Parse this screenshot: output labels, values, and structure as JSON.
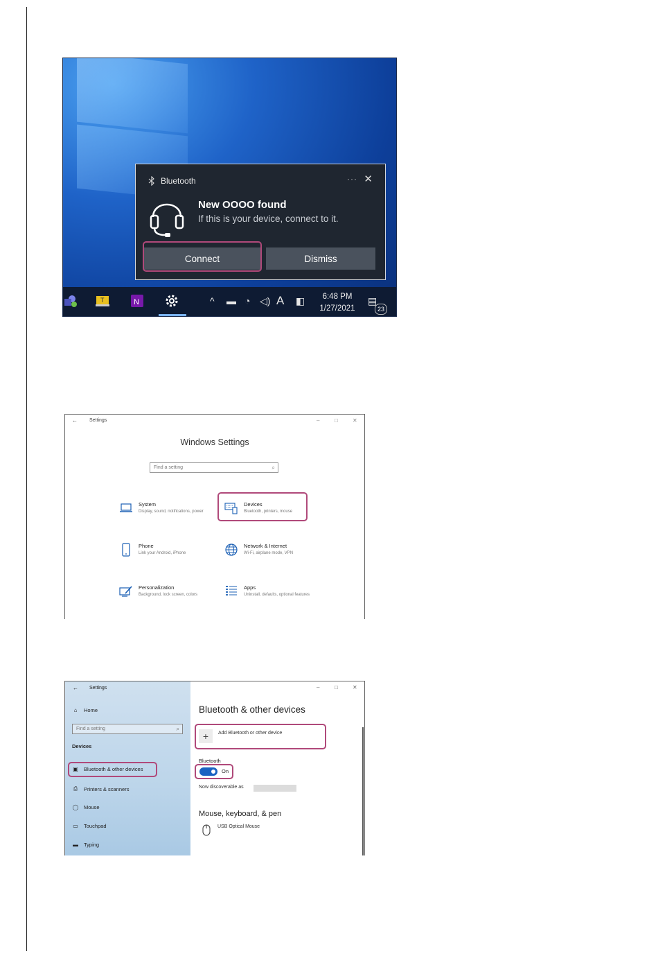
{
  "screen1": {
    "toast": {
      "app_name": "Bluetooth",
      "more": "···",
      "close": "✕",
      "title": "New OOOO found",
      "message": "If this is your device, connect to it.",
      "connect_label": "Connect",
      "dismiss_label": "Dismiss"
    },
    "taskbar": {
      "time": "6:48 PM",
      "date": "1/27/2021",
      "notification_count": "23",
      "tray_chevron": "^",
      "tray_input": "A"
    }
  },
  "screen2": {
    "window_app": "Settings",
    "title": "Windows Settings",
    "search_placeholder": "Find a setting",
    "tiles": [
      {
        "name": "System",
        "desc": "Display, sound, notifications, power"
      },
      {
        "name": "Devices",
        "desc": "Bluetooth, printers, mouse"
      },
      {
        "name": "Phone",
        "desc": "Link your Android, iPhone"
      },
      {
        "name": "Network & Internet",
        "desc": "Wi-Fi, airplane mode, VPN"
      },
      {
        "name": "Personalization",
        "desc": "Background, lock screen, colors"
      },
      {
        "name": "Apps",
        "desc": "Uninstall, defaults, optional features"
      }
    ]
  },
  "screen3": {
    "window_app": "Settings",
    "sidebar": {
      "home": "Home",
      "search_placeholder": "Find a setting",
      "section": "Devices",
      "items": [
        "Bluetooth & other devices",
        "Printers & scanners",
        "Mouse",
        "Touchpad",
        "Typing"
      ]
    },
    "main": {
      "title": "Bluetooth & other devices",
      "add_label": "Add Bluetooth or other device",
      "bluetooth_label": "Bluetooth",
      "toggle_state": "On",
      "discoverable": "Now discoverable as",
      "section_title": "Mouse, keyboard, & pen",
      "device_name": "USB Optical Mouse"
    }
  },
  "colors": {
    "highlight": "#b0497a",
    "toggle_on": "#1a63c2",
    "toast_bg": "#1f2630"
  }
}
